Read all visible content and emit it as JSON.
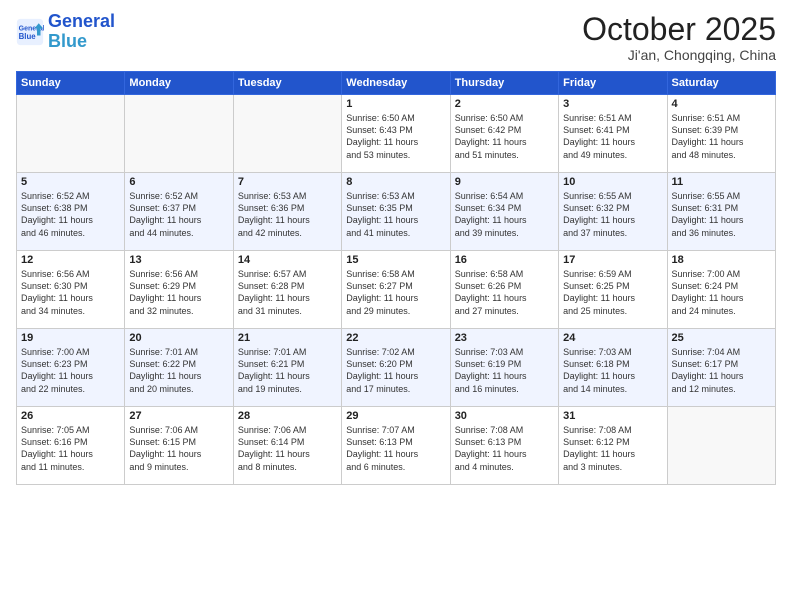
{
  "header": {
    "logo_line1": "General",
    "logo_line2": "Blue",
    "title": "October 2025",
    "subtitle": "Ji'an, Chongqing, China"
  },
  "weekdays": [
    "Sunday",
    "Monday",
    "Tuesday",
    "Wednesday",
    "Thursday",
    "Friday",
    "Saturday"
  ],
  "weeks": [
    [
      {
        "day": "",
        "info": ""
      },
      {
        "day": "",
        "info": ""
      },
      {
        "day": "",
        "info": ""
      },
      {
        "day": "1",
        "info": "Sunrise: 6:50 AM\nSunset: 6:43 PM\nDaylight: 11 hours\nand 53 minutes."
      },
      {
        "day": "2",
        "info": "Sunrise: 6:50 AM\nSunset: 6:42 PM\nDaylight: 11 hours\nand 51 minutes."
      },
      {
        "day": "3",
        "info": "Sunrise: 6:51 AM\nSunset: 6:41 PM\nDaylight: 11 hours\nand 49 minutes."
      },
      {
        "day": "4",
        "info": "Sunrise: 6:51 AM\nSunset: 6:39 PM\nDaylight: 11 hours\nand 48 minutes."
      }
    ],
    [
      {
        "day": "5",
        "info": "Sunrise: 6:52 AM\nSunset: 6:38 PM\nDaylight: 11 hours\nand 46 minutes."
      },
      {
        "day": "6",
        "info": "Sunrise: 6:52 AM\nSunset: 6:37 PM\nDaylight: 11 hours\nand 44 minutes."
      },
      {
        "day": "7",
        "info": "Sunrise: 6:53 AM\nSunset: 6:36 PM\nDaylight: 11 hours\nand 42 minutes."
      },
      {
        "day": "8",
        "info": "Sunrise: 6:53 AM\nSunset: 6:35 PM\nDaylight: 11 hours\nand 41 minutes."
      },
      {
        "day": "9",
        "info": "Sunrise: 6:54 AM\nSunset: 6:34 PM\nDaylight: 11 hours\nand 39 minutes."
      },
      {
        "day": "10",
        "info": "Sunrise: 6:55 AM\nSunset: 6:32 PM\nDaylight: 11 hours\nand 37 minutes."
      },
      {
        "day": "11",
        "info": "Sunrise: 6:55 AM\nSunset: 6:31 PM\nDaylight: 11 hours\nand 36 minutes."
      }
    ],
    [
      {
        "day": "12",
        "info": "Sunrise: 6:56 AM\nSunset: 6:30 PM\nDaylight: 11 hours\nand 34 minutes."
      },
      {
        "day": "13",
        "info": "Sunrise: 6:56 AM\nSunset: 6:29 PM\nDaylight: 11 hours\nand 32 minutes."
      },
      {
        "day": "14",
        "info": "Sunrise: 6:57 AM\nSunset: 6:28 PM\nDaylight: 11 hours\nand 31 minutes."
      },
      {
        "day": "15",
        "info": "Sunrise: 6:58 AM\nSunset: 6:27 PM\nDaylight: 11 hours\nand 29 minutes."
      },
      {
        "day": "16",
        "info": "Sunrise: 6:58 AM\nSunset: 6:26 PM\nDaylight: 11 hours\nand 27 minutes."
      },
      {
        "day": "17",
        "info": "Sunrise: 6:59 AM\nSunset: 6:25 PM\nDaylight: 11 hours\nand 25 minutes."
      },
      {
        "day": "18",
        "info": "Sunrise: 7:00 AM\nSunset: 6:24 PM\nDaylight: 11 hours\nand 24 minutes."
      }
    ],
    [
      {
        "day": "19",
        "info": "Sunrise: 7:00 AM\nSunset: 6:23 PM\nDaylight: 11 hours\nand 22 minutes."
      },
      {
        "day": "20",
        "info": "Sunrise: 7:01 AM\nSunset: 6:22 PM\nDaylight: 11 hours\nand 20 minutes."
      },
      {
        "day": "21",
        "info": "Sunrise: 7:01 AM\nSunset: 6:21 PM\nDaylight: 11 hours\nand 19 minutes."
      },
      {
        "day": "22",
        "info": "Sunrise: 7:02 AM\nSunset: 6:20 PM\nDaylight: 11 hours\nand 17 minutes."
      },
      {
        "day": "23",
        "info": "Sunrise: 7:03 AM\nSunset: 6:19 PM\nDaylight: 11 hours\nand 16 minutes."
      },
      {
        "day": "24",
        "info": "Sunrise: 7:03 AM\nSunset: 6:18 PM\nDaylight: 11 hours\nand 14 minutes."
      },
      {
        "day": "25",
        "info": "Sunrise: 7:04 AM\nSunset: 6:17 PM\nDaylight: 11 hours\nand 12 minutes."
      }
    ],
    [
      {
        "day": "26",
        "info": "Sunrise: 7:05 AM\nSunset: 6:16 PM\nDaylight: 11 hours\nand 11 minutes."
      },
      {
        "day": "27",
        "info": "Sunrise: 7:06 AM\nSunset: 6:15 PM\nDaylight: 11 hours\nand 9 minutes."
      },
      {
        "day": "28",
        "info": "Sunrise: 7:06 AM\nSunset: 6:14 PM\nDaylight: 11 hours\nand 8 minutes."
      },
      {
        "day": "29",
        "info": "Sunrise: 7:07 AM\nSunset: 6:13 PM\nDaylight: 11 hours\nand 6 minutes."
      },
      {
        "day": "30",
        "info": "Sunrise: 7:08 AM\nSunset: 6:13 PM\nDaylight: 11 hours\nand 4 minutes."
      },
      {
        "day": "31",
        "info": "Sunrise: 7:08 AM\nSunset: 6:12 PM\nDaylight: 11 hours\nand 3 minutes."
      },
      {
        "day": "",
        "info": ""
      }
    ]
  ]
}
